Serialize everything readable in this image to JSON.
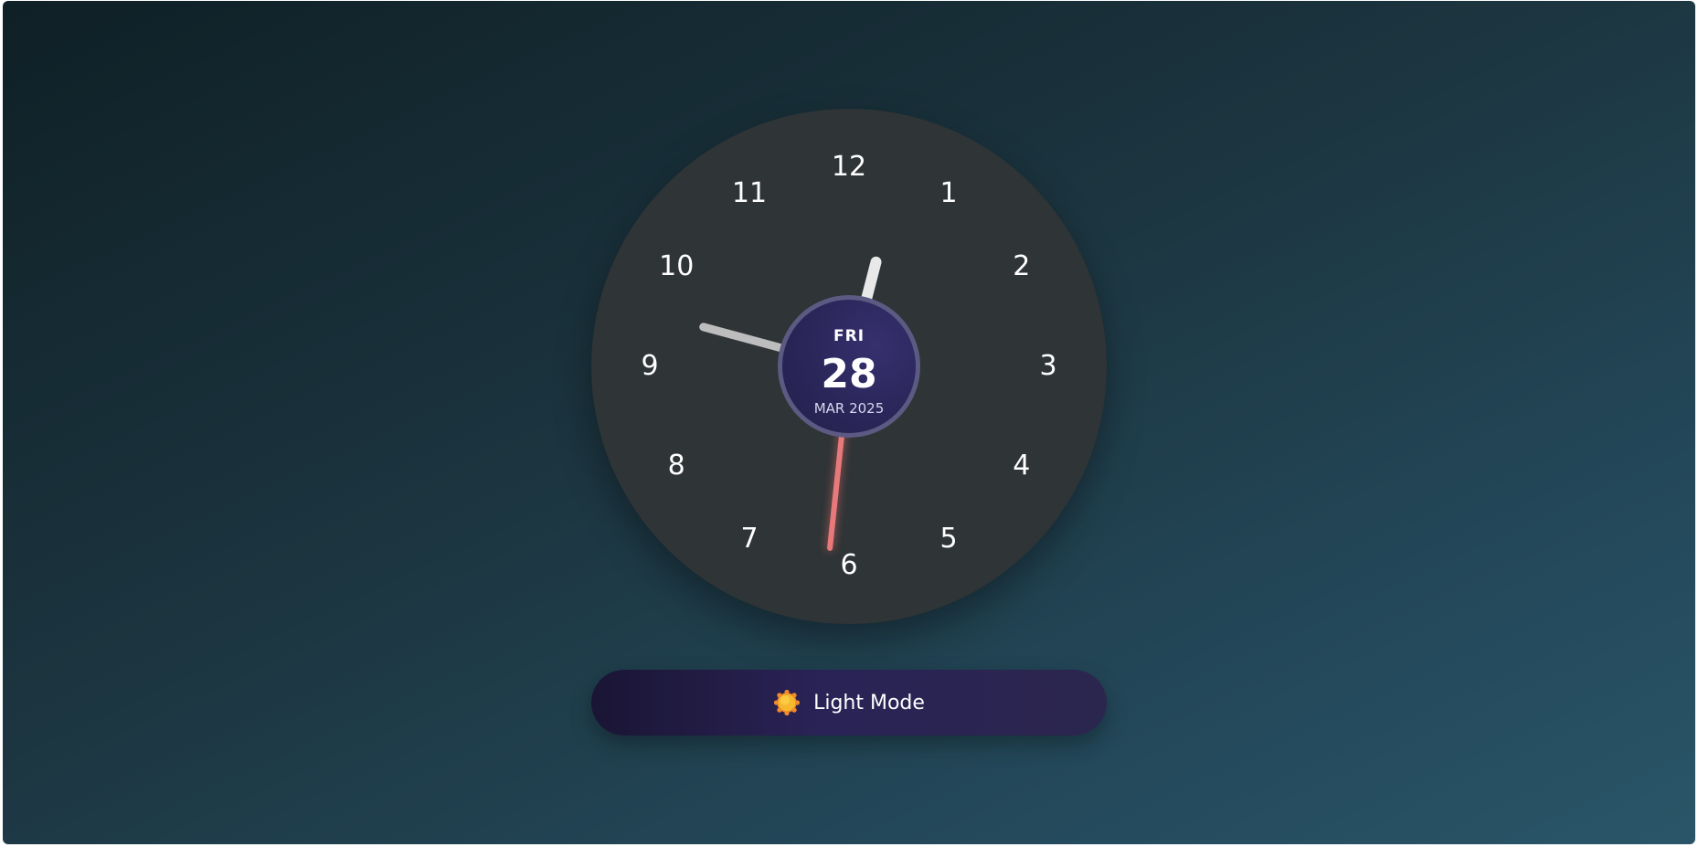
{
  "clock": {
    "numerals": [
      "12",
      "1",
      "2",
      "3",
      "4",
      "5",
      "6",
      "7",
      "8",
      "9",
      "10",
      "11"
    ],
    "time": {
      "hour": 12,
      "minute": 47,
      "second": 31
    },
    "date": {
      "day": "FRI",
      "number": "28",
      "month_year": "MAR 2025"
    },
    "colors": {
      "face": "#2f3436",
      "hour_hand": "#e8e8e8",
      "minute_hand": "#bdbdbd",
      "second_hand": "#e8797a",
      "date_disc": "#2a2659"
    }
  },
  "mode_toggle": {
    "icon": "sun-icon",
    "label": "Light Mode"
  }
}
